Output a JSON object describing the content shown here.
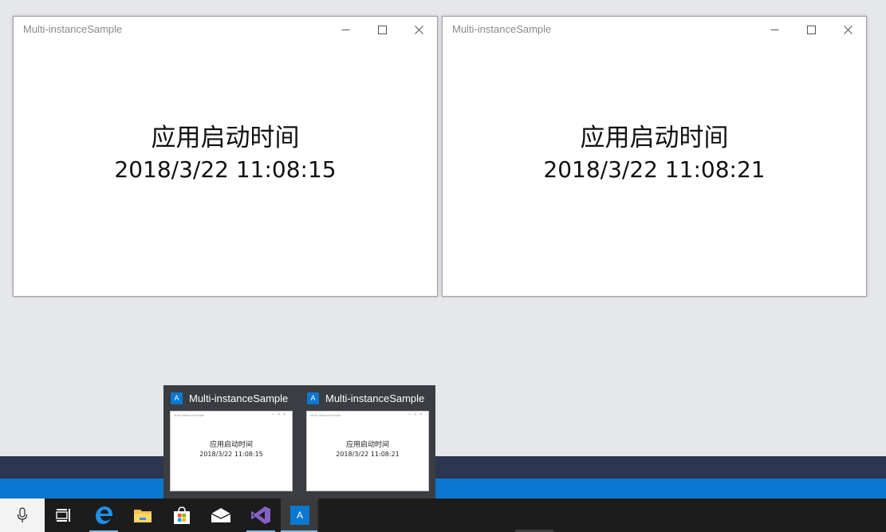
{
  "windows": [
    {
      "title": "Multi-instanceSample",
      "heading": "应用启动时间",
      "timestamp": "2018/3/22 11:08:15"
    },
    {
      "title": "Multi-instanceSample",
      "heading": "应用启动时间",
      "timestamp": "2018/3/22 11:08:21"
    }
  ],
  "thumbnails": [
    {
      "title": "Multi-instanceSample",
      "icon_letter": "A",
      "preview_title": "Multi-instanceSample",
      "preview_heading": "应用启动时间",
      "preview_timestamp": "2018/3/22 11:08:15"
    },
    {
      "title": "Multi-instanceSample",
      "icon_letter": "A",
      "preview_title": "Multi-instanceSample",
      "preview_heading": "应用启动时间",
      "preview_timestamp": "2018/3/22 11:08:21"
    }
  ],
  "taskbar": {
    "items": [
      {
        "icon": "microphone-icon"
      },
      {
        "icon": "task-view-icon"
      },
      {
        "icon": "edge-icon"
      },
      {
        "icon": "file-explorer-icon"
      },
      {
        "icon": "store-icon"
      },
      {
        "icon": "mail-icon"
      },
      {
        "icon": "visual-studio-icon"
      },
      {
        "icon": "app-icon",
        "letter": "A"
      }
    ]
  },
  "colors": {
    "desktop": "#e6e7ea",
    "accent": "#0a78d0",
    "taskbar": "#1c1c1c",
    "popup": "#3a3d42"
  }
}
